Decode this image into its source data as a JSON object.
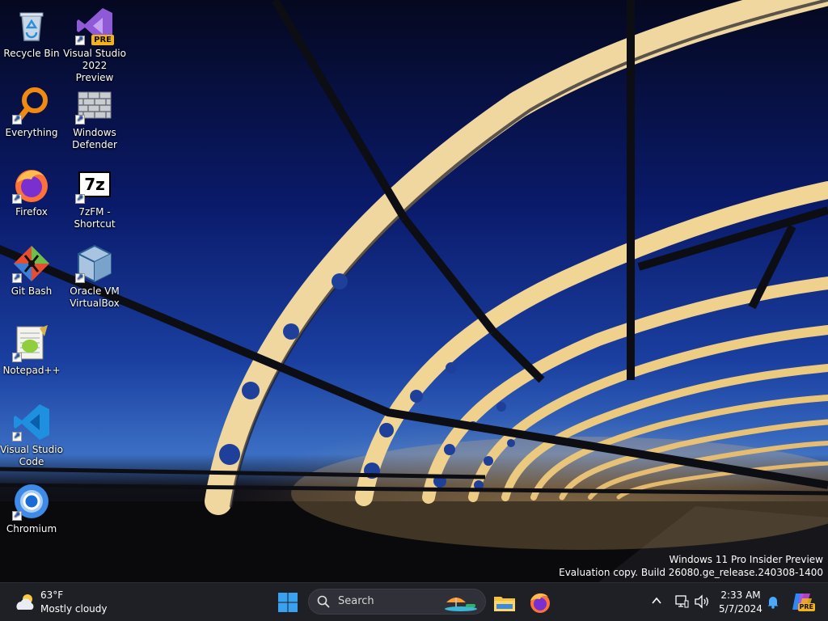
{
  "desktop": {
    "icons": [
      {
        "label": "Recycle Bin"
      },
      {
        "label": "Visual Studio 2022 Preview",
        "badge": "PRE"
      },
      {
        "label": "Everything"
      },
      {
        "label": "Windows Defender"
      },
      {
        "label": "Firefox"
      },
      {
        "label": "7zFM - Shortcut",
        "glyph_text": "7z"
      },
      {
        "label": "Git Bash"
      },
      {
        "label": "Oracle VM VirtualBox"
      },
      {
        "label": "Notepad++"
      },
      {
        "label": "Visual Studio Code"
      },
      {
        "label": "Chromium"
      }
    ],
    "shortcut_arrow": "↗"
  },
  "watermark": {
    "line1": "Windows 11 Pro Insider Preview",
    "line2": "Evaluation copy. Build 26080.ge_release.240308-1400"
  },
  "taskbar": {
    "weather": {
      "temp": "63°F",
      "condition": "Mostly cloudy",
      "icon": "cloud-sun-icon"
    },
    "search": {
      "placeholder": "Search"
    },
    "apps": [
      "file-explorer-icon",
      "firefox-icon"
    ],
    "tray": {
      "chevron": "^"
    },
    "clock": {
      "time": "2:33 AM",
      "date": "5/7/2024"
    },
    "copilot_badge": "PRE"
  },
  "colors": {
    "taskbar_bg": "#1f2026",
    "accent_blue": "#0a66e0"
  }
}
